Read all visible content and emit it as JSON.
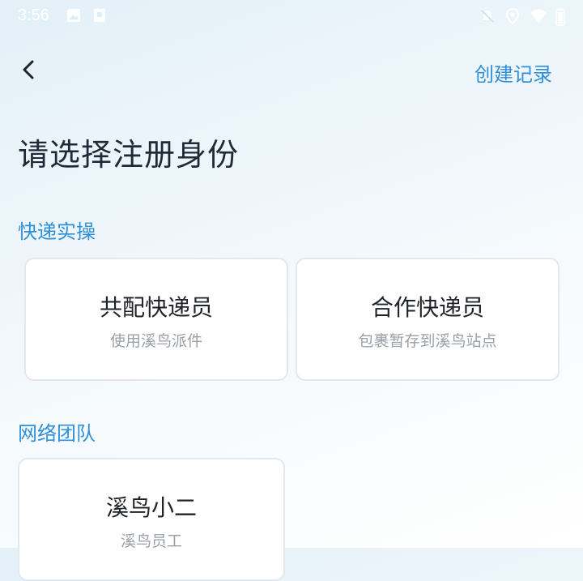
{
  "status_bar": {
    "time": "3:56",
    "left_icons": [
      "image-icon",
      "notification-icon"
    ],
    "right_icons": [
      "mute-icon",
      "location-icon",
      "wifi-icon",
      "battery-icon"
    ]
  },
  "nav": {
    "back_icon": "back-arrow-icon",
    "right_action": "创建记录"
  },
  "page": {
    "title": "请选择注册身份"
  },
  "sections": [
    {
      "title": "快递实操",
      "cards": [
        {
          "title": "共配快递员",
          "subtitle": "使用溪鸟派件"
        },
        {
          "title": "合作快递员",
          "subtitle": "包裹暂存到溪鸟站点"
        }
      ]
    },
    {
      "title": "网络团队",
      "cards": [
        {
          "title": "溪鸟小二",
          "subtitle": "溪鸟员工"
        }
      ]
    }
  ],
  "colors": {
    "accent": "#2f8fd8",
    "title_text": "#1f2a37",
    "subtitle_text": "#9aa0a8",
    "card_border": "#e3e7ee"
  }
}
